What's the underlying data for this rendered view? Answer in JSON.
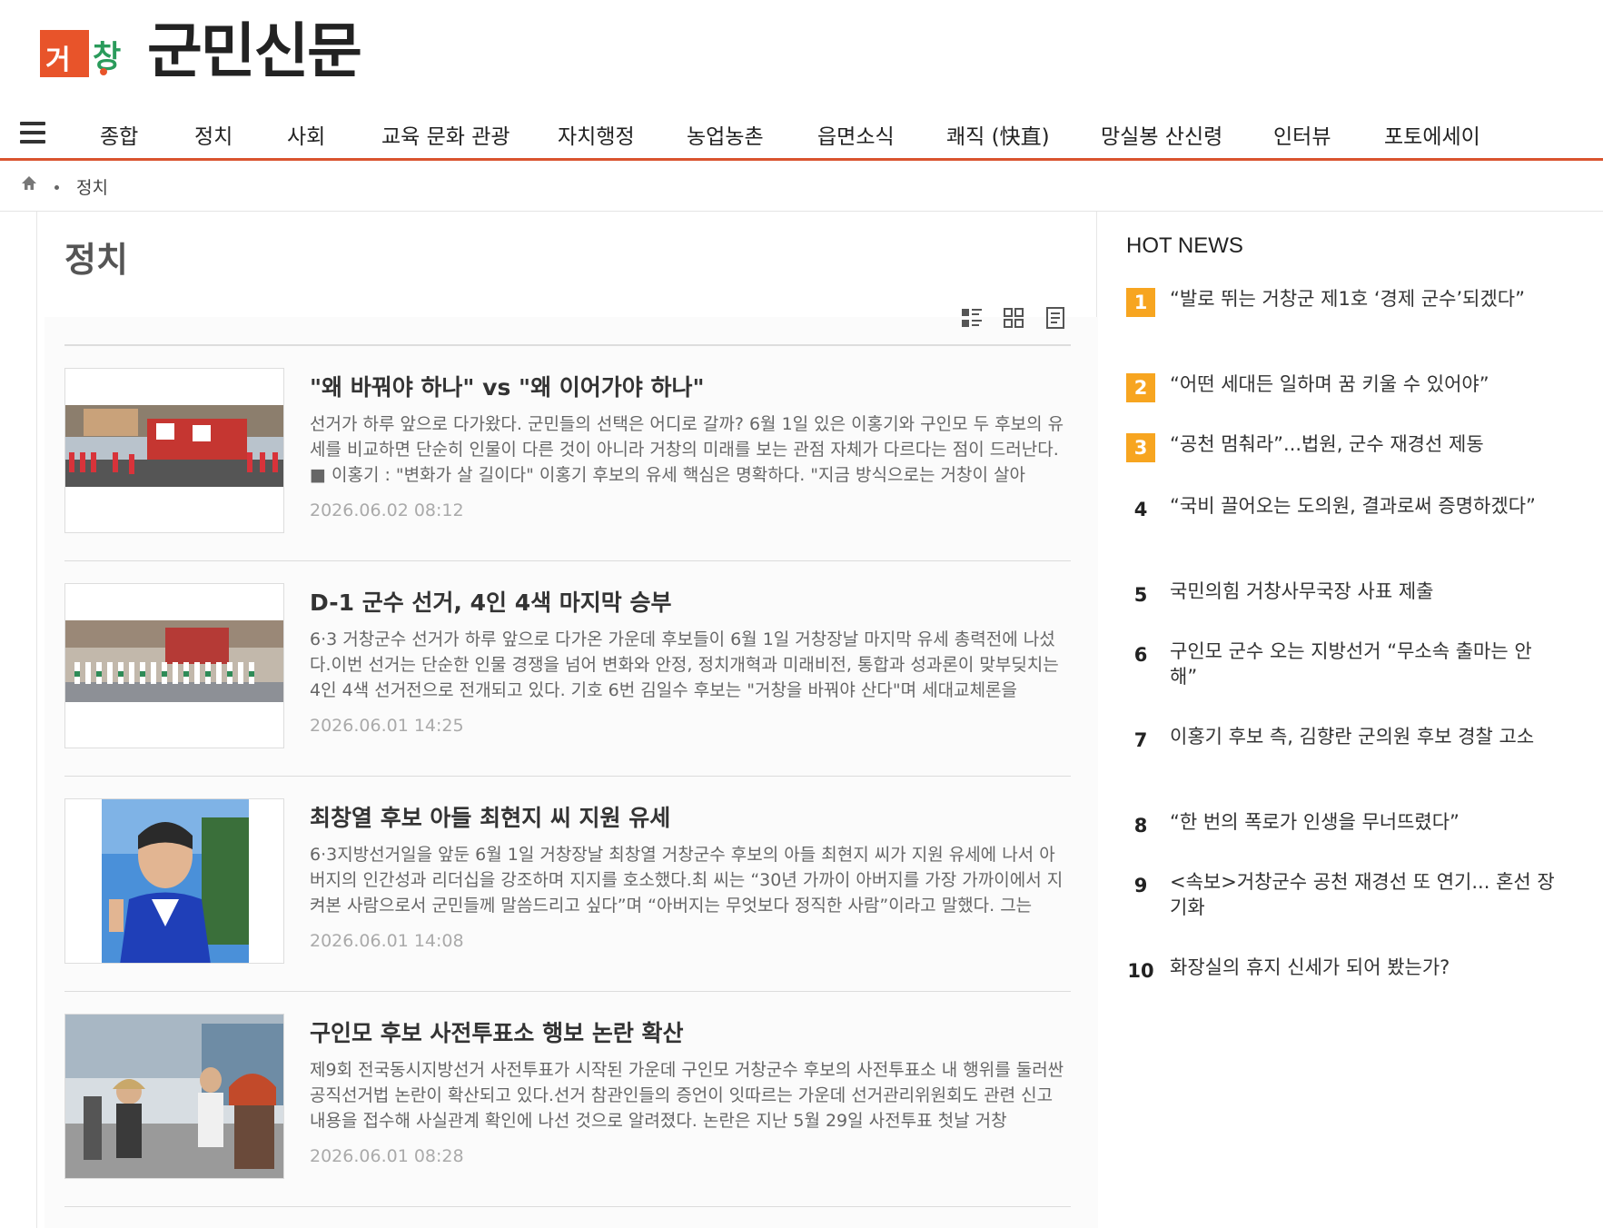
{
  "brand": {
    "logo_mark_left": "거",
    "logo_mark_right": "창",
    "name": "군민신문"
  },
  "nav": {
    "items": [
      "종합",
      "정치",
      "사회",
      "교육 문화 관광",
      "자치행정",
      "농업농촌",
      "읍면소식",
      "쾌직 (快直)",
      "망실봉 산신령",
      "인터뷰",
      "포토에세이"
    ]
  },
  "breadcrumb": {
    "current": "정치"
  },
  "section": {
    "title": "정치"
  },
  "articles": [
    {
      "title": "\"왜 바꿔야 하나\" vs \"왜 이어가야 하나\"",
      "summary": "선거가 하루 앞으로 다가왔다. 군민들의 선택은 어디로 갈까? 6월 1일 있은 이홍기와 구인모 두 후보의 유세를 비교하면 단순히 인물이 다른 것이 아니라 거창의 미래를 보는 관점 자체가 다르다는 점이 드러난다. ■ 이홍기 : \"변화가 살 길이다\" 이홍기 후보의 유세 핵심은 명확하다. \"지금 방식으로는 거창이 살아",
      "date": "2026.06.02 08:12"
    },
    {
      "title": "D-1 군수 선거, 4인 4색 마지막 승부",
      "summary": "6·3 거창군수 선거가 하루 앞으로 다가온 가운데 후보들이 6월 1일 거창장날 마지막 유세 총력전에 나섰다.이번 선거는 단순한 인물 경쟁을 넘어 변화와 안정, 정치개혁과 미래비전, 통합과 성과론이 맞부딪치는 4인 4색 선거전으로 전개되고 있다. 기호 6번 김일수 후보는 \"거창을 바꿔야 산다\"며 세대교체론을",
      "date": "2026.06.01 14:25"
    },
    {
      "title": "최창열 후보 아들 최현지 씨 지원 유세",
      "summary": "6·3지방선거일을 앞둔 6월 1일 거창장날 최창열 거창군수 후보의 아들 최현지 씨가 지원 유세에 나서 아버지의 인간성과 리더십을 강조하며 지지를 호소했다.최 씨는 “30년 가까이 아버지를 가장 가까이에서 지켜본 사람으로서 군민들께 말씀드리고 싶다”며 “아버지는 무엇보다 정직한 사람”이라고 말했다. 그는",
      "date": "2026.06.01 14:08"
    },
    {
      "title": "구인모 후보 사전투표소 행보 논란 확산",
      "summary": "제9회 전국동시지방선거 사전투표가 시작된 가운데 구인모 거창군수 후보의 사전투표소 내 행위를 둘러싼 공직선거법 논란이 확산되고 있다.선거 참관인들의 증언이 잇따르는 가운데 선거관리위원회도 관련 신고 내용을 접수해 사실관계 확인에 나선 것으로 알려졌다. 논란은 지난 5월 29일 사전투표 첫날 거창",
      "date": "2026.06.01 08:28"
    }
  ],
  "hot_news": {
    "title": "HOT NEWS",
    "items": [
      {
        "rank": "1",
        "text": "“발로 뛰는 거창군 제1호 ‘경제 군수’되겠다”"
      },
      {
        "rank": "2",
        "text": "“어떤 세대든 일하며 꿈 키울 수 있어야”"
      },
      {
        "rank": "3",
        "text": "“공천 멈춰라”...법원, 군수 재경선 제동"
      },
      {
        "rank": "4",
        "text": "“국비 끌어오는 도의원, 결과로써 증명하겠다”"
      },
      {
        "rank": "5",
        "text": "국민의힘 거창사무국장 사표 제출"
      },
      {
        "rank": "6",
        "text": "구인모 군수 오는 지방선거 “무소속 출마는 안 해”"
      },
      {
        "rank": "7",
        "text": "이홍기 후보 측, 김향란 군의원 후보 경찰 고소"
      },
      {
        "rank": "8",
        "text": "“한 번의 폭로가 인생을 무너뜨렸다”"
      },
      {
        "rank": "9",
        "text": "<속보>거창군수 공천 재경선 또 연기... 혼선 장기화"
      },
      {
        "rank": "10",
        "text": "화장실의 휴지 신세가 되어 봤는가?"
      }
    ]
  },
  "colors": {
    "accent": "#d9542f",
    "rank_highlight": "#f7a520"
  }
}
